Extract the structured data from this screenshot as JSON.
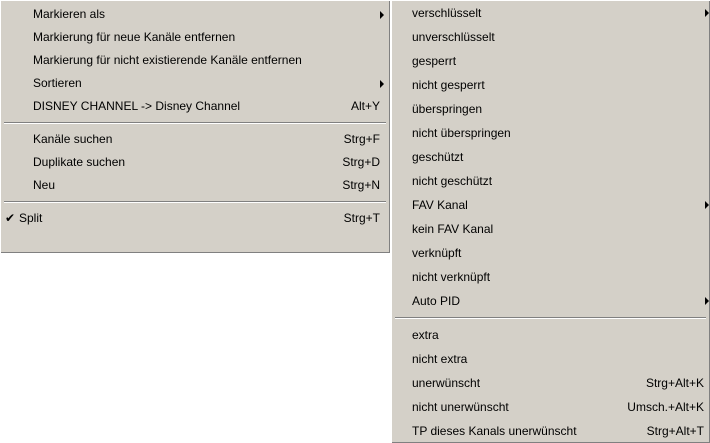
{
  "main_menu": {
    "items": [
      {
        "label": "Markieren als",
        "shortcut": "",
        "submenu": true
      },
      {
        "label": "Markierung für neue Kanäle entfernen",
        "shortcut": ""
      },
      {
        "label": "Markierung für nicht existierende Kanäle entfernen",
        "shortcut": ""
      },
      {
        "label": "Sortieren",
        "shortcut": "",
        "submenu": true
      },
      {
        "label": "DISNEY CHANNEL -> Disney Channel",
        "shortcut": "Alt+Y"
      },
      {
        "label": "Kanäle suchen",
        "shortcut": "Strg+F"
      },
      {
        "label": "Duplikate suchen",
        "shortcut": "Strg+D"
      },
      {
        "label": "Neu",
        "shortcut": "Strg+N"
      },
      {
        "label": "Split",
        "shortcut": "Strg+T",
        "checked": true,
        "check_mark": "✔"
      }
    ]
  },
  "sub_menu": {
    "items": [
      {
        "label": "verschlüsselt",
        "submenu": true
      },
      {
        "label": "unverschlüsselt"
      },
      {
        "label": "gesperrt"
      },
      {
        "label": "nicht gesperrt"
      },
      {
        "label": "überspringen"
      },
      {
        "label": "nicht überspringen"
      },
      {
        "label": "geschützt"
      },
      {
        "label": "nicht geschützt"
      },
      {
        "label": "FAV Kanal",
        "submenu": true
      },
      {
        "label": "kein FAV Kanal"
      },
      {
        "label": "verknüpft"
      },
      {
        "label": "nicht verknüpft"
      },
      {
        "label": "Auto PID",
        "submenu": true
      },
      {
        "label": "extra"
      },
      {
        "label": "nicht extra"
      },
      {
        "label": "unerwünscht",
        "shortcut": "Strg+Alt+K"
      },
      {
        "label": "nicht unerwünscht",
        "shortcut": "Umsch.+Alt+K"
      },
      {
        "label": "TP dieses Kanals unerwünscht",
        "shortcut": "Strg+Alt+T"
      }
    ]
  },
  "colors": {
    "menu_bg": "#d4d0c8",
    "text": "#000000"
  }
}
